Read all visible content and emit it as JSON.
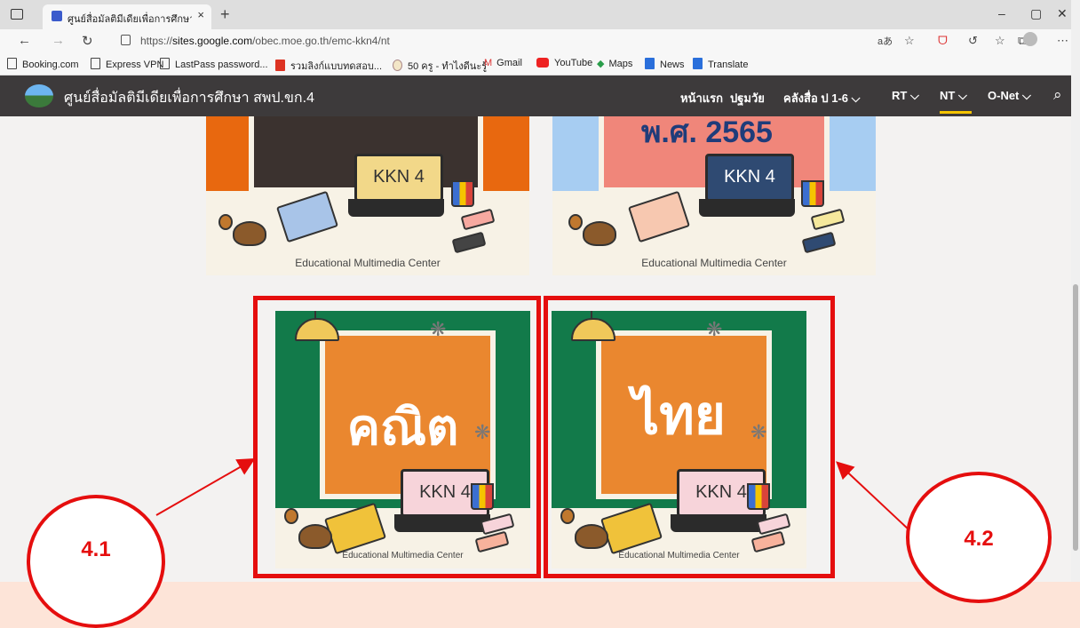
{
  "browser": {
    "tab_title": "ศูนย์สื่อมัลติมีเดียเพื่อการศึกษา สพป.ข",
    "tab_close": "×",
    "new_tab": "+",
    "url_prefix": "https://",
    "url_domain": "sites.google.com",
    "url_path": "/obec.moe.go.th/emc-kkn4/nt",
    "win_min": "–",
    "win_max": "▢",
    "win_close": "✕"
  },
  "bookmarks": [
    {
      "label": "Booking.com",
      "icon": "page-icon"
    },
    {
      "label": "Express VPN",
      "icon": "page-icon"
    },
    {
      "label": "LastPass password...",
      "icon": "page-icon"
    },
    {
      "label": "รวมลิงก์แบบทดสอบ...",
      "icon": "red-calendar-icon"
    },
    {
      "label": "50 ครู - ทำไงดีนะรู้",
      "icon": "circle-icon"
    },
    {
      "label": "Gmail",
      "icon": "gmail-icon"
    },
    {
      "label": "YouTube",
      "icon": "youtube-icon"
    },
    {
      "label": "Maps",
      "icon": "maps-icon"
    },
    {
      "label": "News",
      "icon": "news-icon"
    },
    {
      "label": "Translate",
      "icon": "translate-icon"
    }
  ],
  "site": {
    "title": "ศูนย์สื่อมัลติมีเดียเพื่อการศึกษา สพป.ขก.4",
    "nav": [
      {
        "label": "หน้าแรก"
      },
      {
        "label": "ปฐมวัย"
      },
      {
        "label": "คลังสื่อ ป 1-6 ⌵"
      },
      {
        "label": "RT ⌵"
      },
      {
        "label": "NT ⌵"
      },
      {
        "label": "O-Net ⌵"
      }
    ]
  },
  "cards": {
    "top_right_text": "พ.ศ. 2565",
    "laptop_text": "KKN 4",
    "caption": "Educational Multimedia Center",
    "math_title": "คณิต",
    "thai_title": "ไทย"
  },
  "annotations": {
    "label_1": "4.1",
    "label_2": "4.2",
    "color": "#e50e0e"
  }
}
